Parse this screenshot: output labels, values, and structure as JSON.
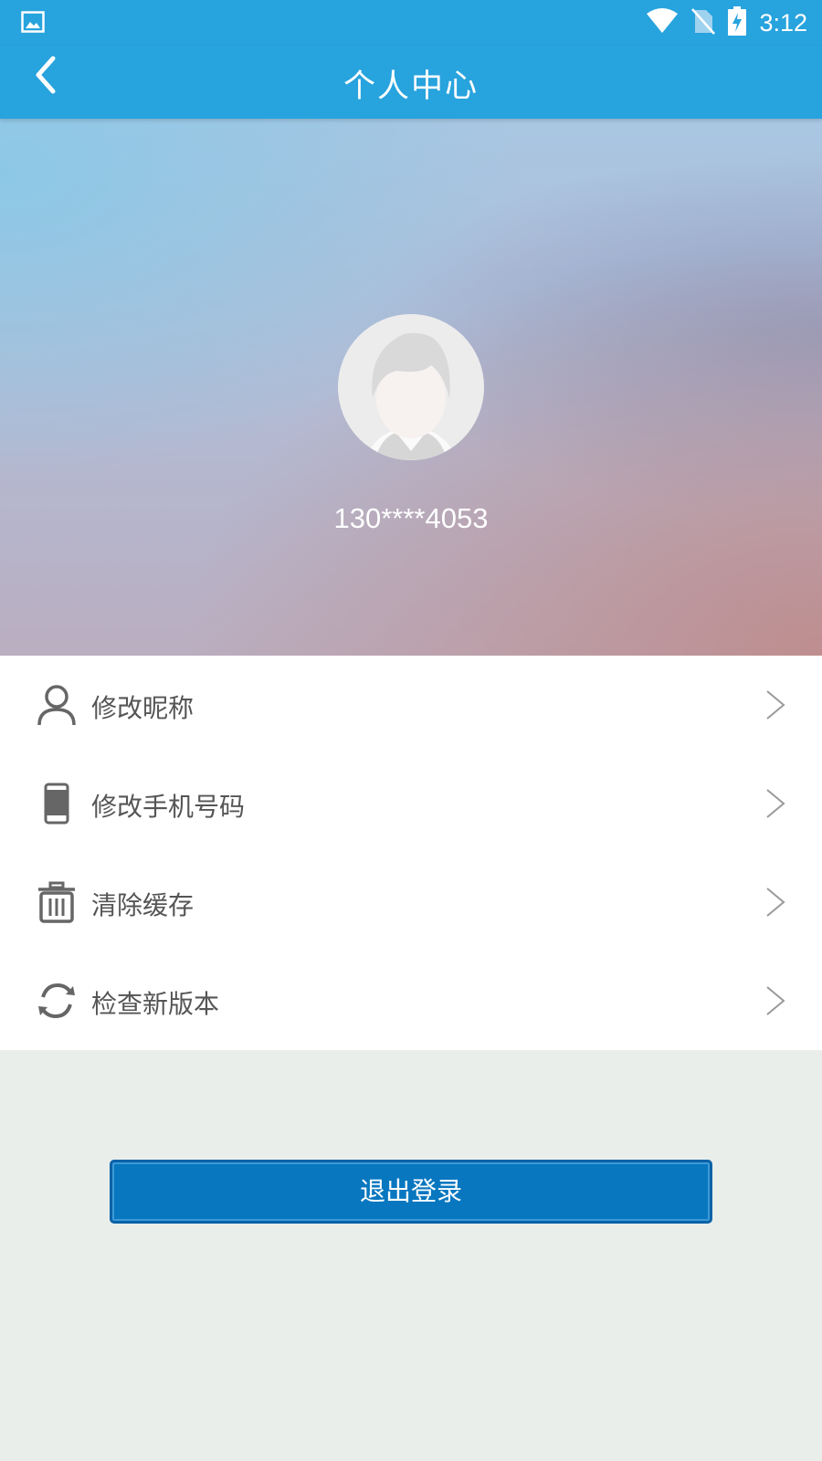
{
  "status_bar": {
    "time": "3:12",
    "icons": [
      "gallery-icon",
      "wifi-icon",
      "no-sim-icon",
      "battery-charging-icon"
    ]
  },
  "app_bar": {
    "title": "个人中心",
    "back_icon": "chevron-left-icon"
  },
  "profile": {
    "avatar_icon": "default-avatar",
    "phone": "130****4053"
  },
  "menu": {
    "items": [
      {
        "label": "修改昵称",
        "icon": "user-icon"
      },
      {
        "label": "修改手机号码",
        "icon": "phone-icon"
      },
      {
        "label": "清除缓存",
        "icon": "trash-icon"
      },
      {
        "label": "检查新版本",
        "icon": "refresh-icon"
      }
    ]
  },
  "logout": {
    "label": "退出登录"
  },
  "colors": {
    "primary": "#27a3dd",
    "button": "#0877c0",
    "background": "#e9eeeb"
  }
}
